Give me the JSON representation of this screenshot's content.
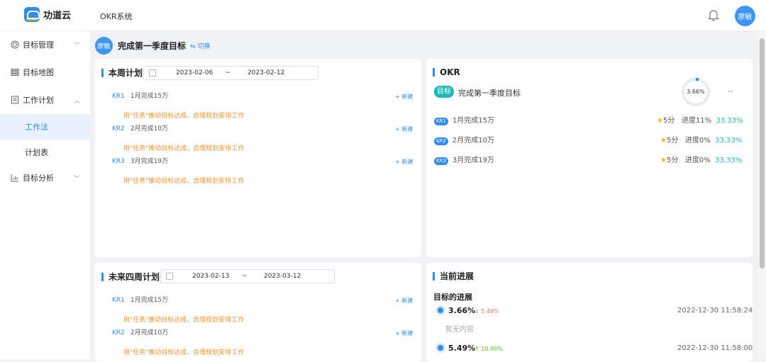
{
  "header": {
    "logo_text": "功道云",
    "app_name": "OKR系统",
    "user_avatar": "廖敏",
    "icons": [
      "bell-icon"
    ]
  },
  "sidebar": {
    "items": [
      {
        "label": "目标管理",
        "icon": "target-icon",
        "chevron": "down"
      },
      {
        "label": "目标地图",
        "icon": "map-icon"
      },
      {
        "label": "工作计划",
        "icon": "document-icon",
        "chevron": "up"
      },
      {
        "label": "工作法",
        "sub": true,
        "active": true
      },
      {
        "label": "计划表",
        "sub": true
      },
      {
        "label": "目标分析",
        "icon": "chart-icon",
        "chevron": "down"
      }
    ]
  },
  "goal_header": {
    "avatar": "廖敏",
    "title": "完成第一季度目标",
    "switch_label": "切换"
  },
  "this_week": {
    "title": "本周计划",
    "date_start": "2023-02-06",
    "date_sep": "~",
    "date_end": "2023-02-12",
    "rows": [
      {
        "tag": "KR1",
        "text": "1月完成15万",
        "new": "+ 新建",
        "hint": "用\"任务\"推动目标达成，合理规划安排工作"
      },
      {
        "tag": "KR2",
        "text": "2月完成10万",
        "new": "+ 新建",
        "hint": "用\"任务\"推动目标达成，合理规划安排工作"
      },
      {
        "tag": "KR3",
        "text": "3月完成19万",
        "new": "+ 新建",
        "hint": "用\"任务\"推动目标达成，合理规划安排工作"
      }
    ]
  },
  "next_four_weeks": {
    "title": "未来四周计划",
    "date_start": "2023-02-13",
    "date_sep": "~",
    "date_end": "2023-03-12",
    "rows": [
      {
        "tag": "KR1",
        "text": "1月完成15万",
        "new": "+ 新建",
        "hint": "用\"任务\"推动目标达成，合理规划安排工作"
      },
      {
        "tag": "KR2",
        "text": "2月完成10万",
        "new": "+ 新建",
        "hint": "用\"任务\"推动目标达成，合理规划安排工作"
      }
    ]
  },
  "okr": {
    "title": "OKR",
    "badge": "目标",
    "goal": "完成第一季度目标",
    "progress_text": "3.66%",
    "progress_value": 0.0366,
    "dashes": "--",
    "krs": [
      {
        "tag": "KR1",
        "text": "1月完成15万",
        "score": "5分",
        "progress": "进度11%",
        "pct": "33.33%"
      },
      {
        "tag": "KR2",
        "text": "2月完成10万",
        "score": "5分",
        "progress": "进度0%",
        "pct": "33.33%"
      },
      {
        "tag": "KR3",
        "text": "3月完成19万",
        "score": "5分",
        "progress": "进度0%",
        "pct": "33.33%"
      }
    ]
  },
  "current_progress": {
    "title": "当前进展",
    "subtitle": "目标的进展",
    "entries": [
      {
        "value": "3.66%",
        "delta": "↓ 5.49%",
        "delta_color": "#f56c6c",
        "time": "2022-12-30 11:58:24",
        "note": "暂无内容"
      },
      {
        "value": "5.49%",
        "delta": "↑ 10.99%",
        "delta_color": "#52c41a",
        "time": "2022-12-30 11:58:00"
      }
    ]
  },
  "colors": {
    "accent": "#2f8cf0",
    "teal": "#1fb8b8",
    "hint": "#f0932b"
  }
}
